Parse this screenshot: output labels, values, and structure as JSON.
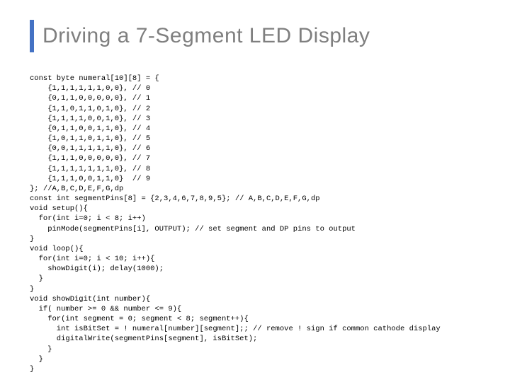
{
  "slide": {
    "title": "Driving a 7-Segment LED Display",
    "code": "const byte numeral[10][8] = {\n    {1,1,1,1,1,1,0,0}, // 0\n    {0,1,1,0,0,0,0,0}, // 1\n    {1,1,0,1,1,0,1,0}, // 2\n    {1,1,1,1,0,0,1,0}, // 3\n    {0,1,1,0,0,1,1,0}, // 4\n    {1,0,1,1,0,1,1,0}, // 5\n    {0,0,1,1,1,1,1,0}, // 6\n    {1,1,1,0,0,0,0,0}, // 7\n    {1,1,1,1,1,1,1,0}, // 8\n    {1,1,1,0,0,1,1,0}  // 9\n}; //A,B,C,D,E,F,G,dp\nconst int segmentPins[8] = {2,3,4,6,7,8,9,5}; // A,B,C,D,E,F,G,dp\nvoid setup(){\n  for(int i=0; i < 8; i++)\n    pinMode(segmentPins[i], OUTPUT); // set segment and DP pins to output\n}\nvoid loop(){\n  for(int i=0; i < 10; i++){\n    showDigit(i); delay(1000);\n  }\n}\nvoid showDigit(int number){\n  if( number >= 0 && number <= 9){\n    for(int segment = 0; segment < 8; segment++){\n      int isBitSet = ! numeral[number][segment];; // remove ! sign if common cathode display\n      digitalWrite(segmentPins[segment], isBitSet);\n    }\n  }\n}"
  }
}
